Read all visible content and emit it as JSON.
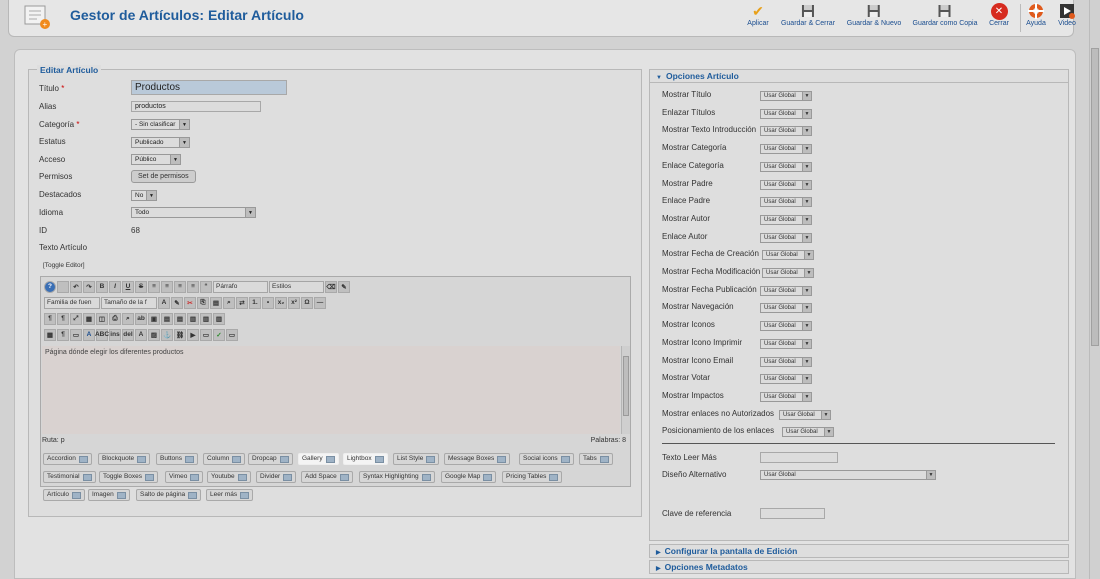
{
  "header": {
    "title": "Gestor de Artículos: Editar Artículo"
  },
  "toolbar": [
    {
      "label": "Aplicar",
      "icon": "check-icon",
      "color": "#e8a019"
    },
    {
      "label": "Guardar & Cerrar",
      "icon": "save-close-icon",
      "color": "#444"
    },
    {
      "label": "Guardar & Nuevo",
      "icon": "save-new-icon",
      "color": "#444"
    },
    {
      "label": "Guardar como Copia",
      "icon": "save-copy-icon",
      "color": "#444"
    },
    {
      "label": "Cerrar",
      "icon": "close-icon",
      "color": "#d62b1f"
    },
    {
      "label": "Ayuda",
      "icon": "help-lifebuoy-icon",
      "color": "#e05a1c"
    },
    {
      "label": "Video",
      "icon": "video-icon",
      "color": "#333"
    }
  ],
  "form": {
    "legend": "Editar Artículo",
    "labels": {
      "titulo": "Título",
      "alias": "Alias",
      "categoria": "Categoría",
      "estatus": "Estatus",
      "acceso": "Acceso",
      "permisos": "Permisos",
      "destacados": "Destacados",
      "idioma": "Idioma",
      "id": "ID",
      "texto": "Texto Artículo"
    },
    "required_mark": "*",
    "values": {
      "titulo": "Productos",
      "alias": "productos",
      "categoria": "- Sin clasificar",
      "estatus": "Publicado",
      "acceso": "Público",
      "permisos_button": "Set de permisos",
      "destacados": "No",
      "idioma": "Todo",
      "id": "68"
    },
    "toggle_editor": "[Toggle Editor]"
  },
  "editor": {
    "format_select": "Párrafo",
    "styles_select": "Estilos",
    "font_family": "Familia de fuen",
    "font_size": "Tamaño de la f",
    "content": "Página dónde elegir los diferentes productos",
    "path_label": "Ruta:",
    "path_value": "p",
    "words_label": "Palabras:",
    "words_value": "8"
  },
  "extension_buttons": [
    "Accordion",
    "Blockquote",
    "Buttons",
    "Column",
    "Dropcap",
    "Gallery",
    "Lightbox",
    "List Style",
    "Message Boxes",
    "Social icons",
    "Tabs",
    "Testimonial",
    "Toggle Boxes",
    "Vimeo",
    "Youtube",
    "Divider",
    "Add Space",
    "Syntax Highlighting",
    "Google Map",
    "Pricing Tables",
    "Artículo",
    "Imagen",
    "Salto de página",
    "Leer más"
  ],
  "options_panel": {
    "title": "Opciones Artículo",
    "rows": [
      "Mostrar Título",
      "Enlazar Títulos",
      "Mostrar Texto Introducción",
      "Mostrar Categoría",
      "Enlace Categoría",
      "Mostrar Padre",
      "Enlace Padre",
      "Mostrar Autor",
      "Enlace Autor",
      "Mostrar Fecha de Creación",
      "Mostrar Fecha Modificación",
      "Mostrar Fecha Publicación",
      "Mostrar Navegación",
      "Mostrar Iconos",
      "Mostrar Icono Imprimir",
      "Mostrar Icono Email",
      "Mostrar Votar",
      "Mostrar Impactos",
      "Mostrar enlaces no Autorizados",
      "Posicionamiento de los enlaces"
    ],
    "global_value": "Usar Global",
    "leer_mas_label": "Texto Leer Más",
    "leer_mas_value": "",
    "diseno_label": "Diseño Alternativo",
    "diseno_value": "Usar Global",
    "clave_label": "Clave de referencia",
    "clave_value": ""
  },
  "collapsed_panels": [
    "Configurar la pantalla de Edición",
    "Opciones Metadatos"
  ]
}
